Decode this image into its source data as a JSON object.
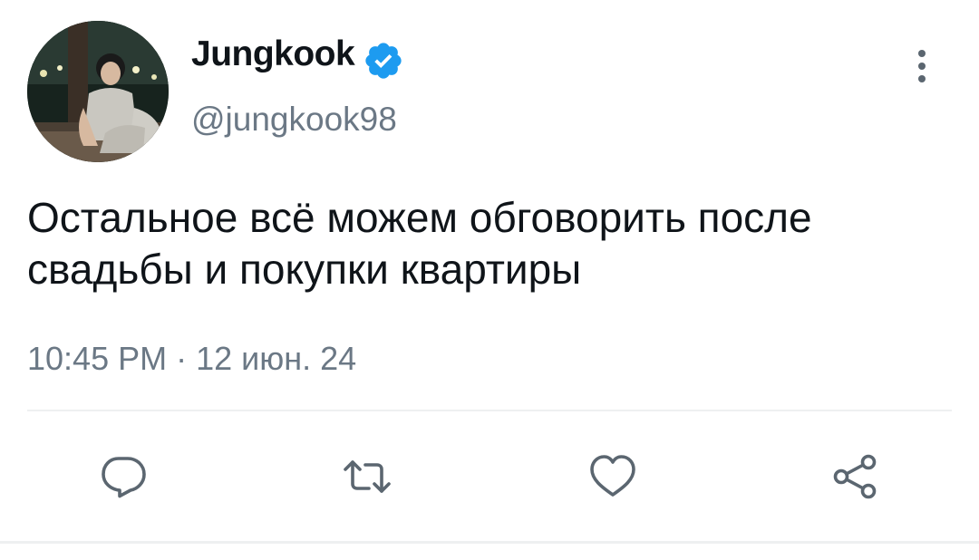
{
  "tweet": {
    "display_name": "Jungkook",
    "handle": "@jungkook98",
    "text": "Остальное всё можем обговорить после свадьбы и покупки квартиры",
    "timestamp": "10:45 PM · 12 июн. 24"
  },
  "icons": {
    "verified": "verified-badge-icon",
    "more": "more-vertical-icon",
    "reply": "reply-icon",
    "retweet": "retweet-icon",
    "like": "heart-icon",
    "share": "share-icon"
  },
  "colors": {
    "verified_blue": "#1d9bf0",
    "action_gray": "#5b6670",
    "text": "#0f1419",
    "secondary_text": "#6b7885"
  }
}
